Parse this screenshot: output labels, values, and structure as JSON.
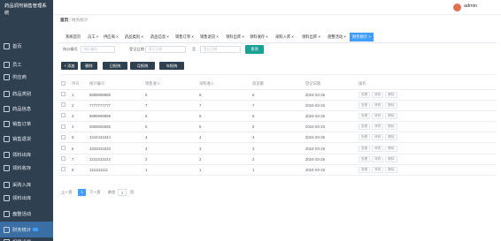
{
  "app": {
    "title": "药品调剂销售管理系统"
  },
  "header": {
    "user": "admin"
  },
  "breadcrumb": {
    "home": "首页",
    "separator": "/",
    "current": "财务统计"
  },
  "sidebar": {
    "items": [
      "首页",
      "员工",
      "供应商",
      "药品类别",
      "药品信息",
      "销售订单",
      "销售退货",
      "领料出库",
      "领料收存",
      "采购入库",
      "领料出库",
      "盘整活动",
      "财务统计",
      "权限设置"
    ]
  },
  "tabs": [
    "系统首页",
    "员工 ×",
    "供应商 ×",
    "药品类别 ×",
    "药品信息 ×",
    "销售订单 ×",
    "销售退货 ×",
    "领料出库 ×",
    "领料收存 ×",
    "采购入库 ×",
    "领料出库 ×",
    "盘整活动 ×",
    "财务统计 ×"
  ],
  "filters": {
    "code_label": "统计编号",
    "code_placeholder": "统计编号",
    "date_label": "登记日期",
    "date_from_placeholder": "登记日期",
    "date_sep": "至",
    "date_to_placeholder": "登记日期",
    "query_button": "查询"
  },
  "actions": [
    "+ 添加",
    "删除",
    "日报统",
    "月报统",
    "年报统"
  ],
  "table": {
    "headers": [
      "序号",
      "统计编号",
      "销售收入",
      "采购收入",
      "退货额",
      "登记日期",
      "操作"
    ],
    "rows": [
      [
        "1",
        "8888888888",
        "6",
        "8",
        "8",
        "2024-03-26"
      ],
      [
        "2",
        "7777777777",
        "7",
        "7",
        "7",
        "2024-03-26"
      ],
      [
        "3",
        "9999999999",
        "6",
        "6",
        "6",
        "2024-03-26"
      ],
      [
        "4",
        "5555555555",
        "5",
        "5",
        "5",
        "2024-03-26"
      ],
      [
        "5",
        "4444444444",
        "4",
        "4",
        "4",
        "2024-03-26"
      ],
      [
        "6",
        "3333333333",
        "3",
        "3",
        "3",
        "2024-03-26"
      ],
      [
        "7",
        "2222222222",
        "2",
        "2",
        "2",
        "2024-03-26"
      ],
      [
        "8",
        "1111111111",
        "1",
        "1",
        "1",
        "2024-03-26"
      ]
    ],
    "row_actions": [
      "查看",
      "修改",
      "删除"
    ]
  },
  "pagination": {
    "prev": "上一页",
    "page": "1",
    "next": "下一页",
    "goto_prefix": "前往",
    "goto_page": "1",
    "goto_suffix": "页"
  }
}
